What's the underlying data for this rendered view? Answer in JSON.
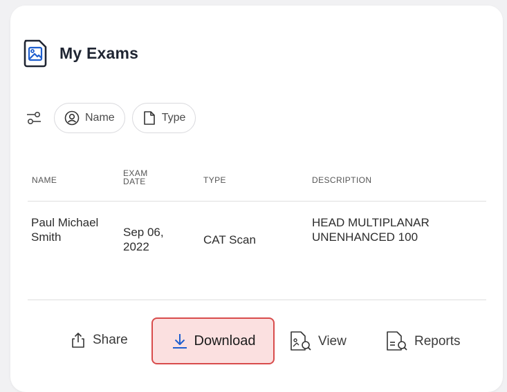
{
  "header": {
    "title": "My Exams",
    "icon": "image-file-icon"
  },
  "filters": {
    "toggle_icon": "filter-sliders-icon",
    "chips": [
      {
        "label": "Name",
        "icon": "user-circle-icon"
      },
      {
        "label": "Type",
        "icon": "file-icon"
      }
    ]
  },
  "table": {
    "columns": [
      "NAME",
      "EXAM DATE",
      "TYPE",
      "DESCRIPTION"
    ],
    "rows": [
      {
        "name": "Paul Michael Smith",
        "date": "Sep 06, 2022",
        "type": "CAT Scan",
        "description": "HEAD MULTIPLANAR UNENHANCED 100"
      }
    ]
  },
  "actions": {
    "share": "Share",
    "download": "Download",
    "view": "View",
    "reports": "Reports"
  },
  "colors": {
    "accent": "#1d5ecf",
    "highlight_fill": "#fbe0e0",
    "highlight_border": "#d84b4b"
  }
}
